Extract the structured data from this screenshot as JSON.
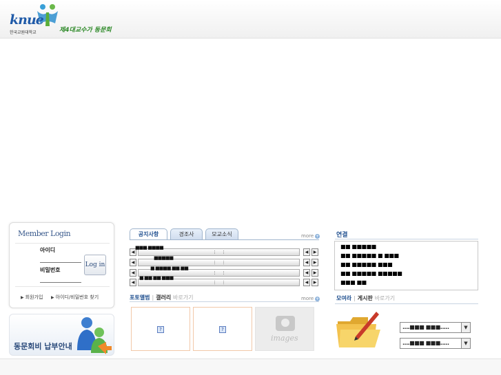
{
  "header": {
    "logo_text": "knue",
    "logo_subtitle": "한국교원대학교",
    "slogan": "제4대교수가 동문회"
  },
  "login": {
    "title": "Member Login",
    "id_label": "아이디",
    "password_label": "비밀번호",
    "login_button": "Log in",
    "signup_link": "회원가입",
    "find_link": "아이디/비밀번호 찾기"
  },
  "dues_banner": {
    "text": "동문회비 납부안내"
  },
  "tabs": [
    {
      "label": "공지사항",
      "active": true
    },
    {
      "label": "경조사",
      "active": false
    },
    {
      "label": "모교소식",
      "active": false
    }
  ],
  "more_label": "more",
  "notices": [
    "■■■ ■■■■",
    "■■■■■",
    "■ ■■■■ ■■ ■■",
    "■ ■■ ■■ ■■■"
  ],
  "photo": {
    "title": "포토앨범",
    "subtitle": "갤러리",
    "shortcut": "바로가기",
    "placeholder_label": "images",
    "broken_icon": "?"
  },
  "links": {
    "title": "연결",
    "items": [
      "■■ ■■■■■",
      "■■ ■■■■■ ■ ■■■",
      "■■ ■■■■■ ■■■",
      "■■ ■■■■■ ■■■■■",
      "■■■ ■■"
    ]
  },
  "gathering": {
    "title": "모여라",
    "subtitle": "게시판",
    "shortcut": "바로가기",
    "select1": "....■■■ ■■■.....",
    "select2": "....■■■ ■■■....."
  },
  "colors": {
    "accent": "#1f4f8f",
    "tab_border": "#9fb4cc",
    "photo_border": "#f2c8a8"
  }
}
